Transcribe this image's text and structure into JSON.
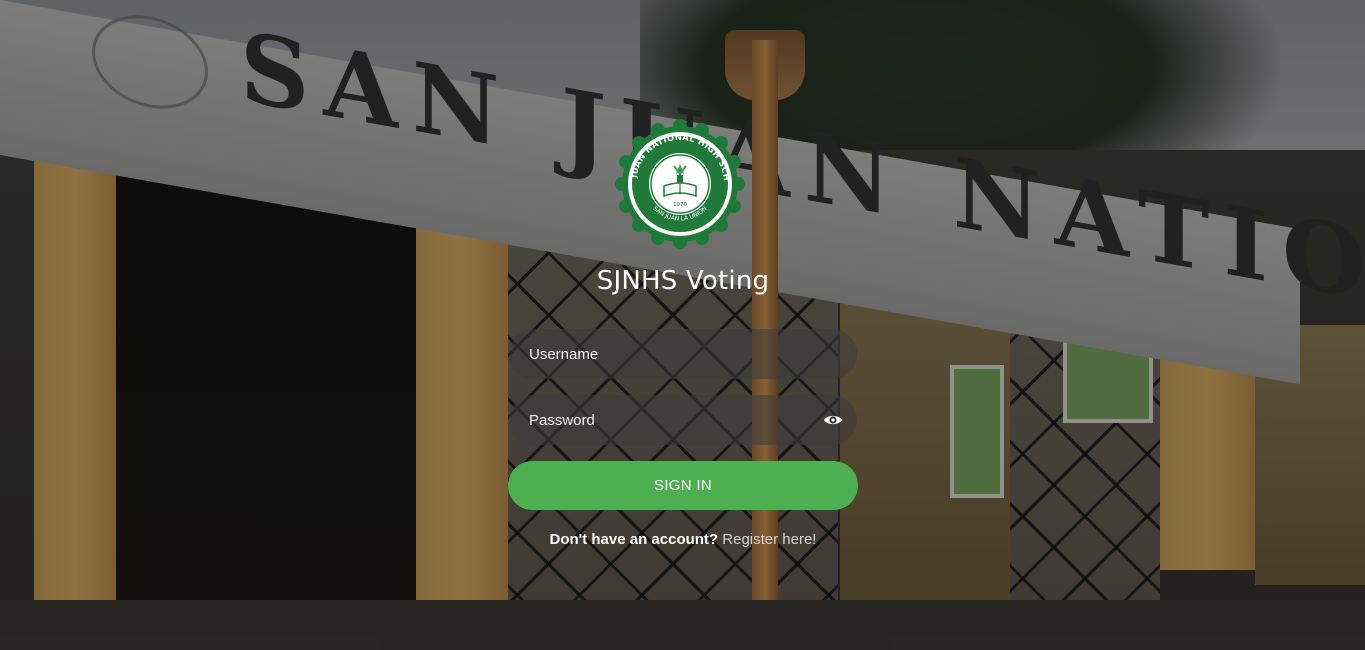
{
  "background": {
    "sign_text": "SAN JUAN NATIONAL HIGH SCHOOL",
    "side_sign_text": "SAN JUAN NAT"
  },
  "logo": {
    "ring_top_text": "SAN JUAN NATIONAL HIGH SCHOOL",
    "ring_bottom_text": "SAN JUAN LA UNION",
    "center_text": "1970"
  },
  "app": {
    "title": "SJNHS Voting"
  },
  "form": {
    "username_placeholder": "Username",
    "password_placeholder": "Password",
    "password_toggle_icon": "eye-icon",
    "submit_label": "SIGN IN",
    "register_prompt": "Don't have an account?",
    "register_link": "Register here!"
  },
  "colors": {
    "primary_green": "#4caf50",
    "input_background": "rgba(60,60,60,0.55)",
    "logo_green": "#1f7a3a"
  }
}
